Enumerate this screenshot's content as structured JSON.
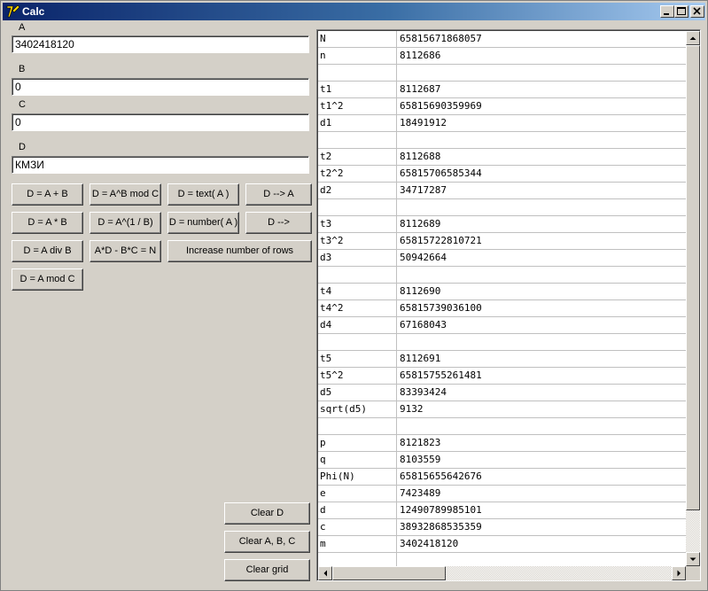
{
  "window": {
    "title": "Calc",
    "icon": "app-icon",
    "controls": [
      "minimize",
      "maximize",
      "close"
    ]
  },
  "fields": {
    "a": {
      "label": "A",
      "value": "3402418120"
    },
    "b": {
      "label": "B",
      "value": "0"
    },
    "c": {
      "label": "C",
      "value": "0"
    },
    "d": {
      "label": "D",
      "value": "КМЗИ"
    }
  },
  "buttons": {
    "add": "D = A + B",
    "powmod": "D = A^B mod C",
    "text": "D = text( A )",
    "d_to_a": "D --> A",
    "mul": "D = A * B",
    "root": "D = A^(1 / B)",
    "number": "D = number( A )",
    "d_arrow": "D -->",
    "div": "D = A div B",
    "det": "A*D - B*C = N",
    "increase_rows": "Increase number of rows",
    "mod": "D = A mod C",
    "clear_d": "Clear D",
    "clear_abc": "Clear A, B, C",
    "clear_grid": "Clear grid"
  },
  "grid": {
    "rows": [
      [
        "N",
        "65815671868057"
      ],
      [
        "n",
        "8112686"
      ],
      [
        "",
        ""
      ],
      [
        "t1",
        "8112687"
      ],
      [
        "t1^2",
        "65815690359969"
      ],
      [
        "d1",
        "18491912"
      ],
      [
        "",
        ""
      ],
      [
        "t2",
        "8112688"
      ],
      [
        "t2^2",
        "65815706585344"
      ],
      [
        "d2",
        "34717287"
      ],
      [
        "",
        ""
      ],
      [
        "t3",
        "8112689"
      ],
      [
        "t3^2",
        "65815722810721"
      ],
      [
        "d3",
        "50942664"
      ],
      [
        "",
        ""
      ],
      [
        "t4",
        "8112690"
      ],
      [
        "t4^2",
        "65815739036100"
      ],
      [
        "d4",
        "67168043"
      ],
      [
        "",
        ""
      ],
      [
        "t5",
        "8112691"
      ],
      [
        "t5^2",
        "65815755261481"
      ],
      [
        "d5",
        "83393424"
      ],
      [
        "sqrt(d5)",
        "9132"
      ],
      [
        "",
        ""
      ],
      [
        "p",
        "8121823"
      ],
      [
        "q",
        "8103559"
      ],
      [
        "Phi(N)",
        "65815655642676"
      ],
      [
        "e",
        "7423489"
      ],
      [
        "d",
        "12490789985101"
      ],
      [
        "c",
        "38932868535359"
      ],
      [
        "m",
        "3402418120"
      ],
      [
        "",
        ""
      ]
    ]
  }
}
